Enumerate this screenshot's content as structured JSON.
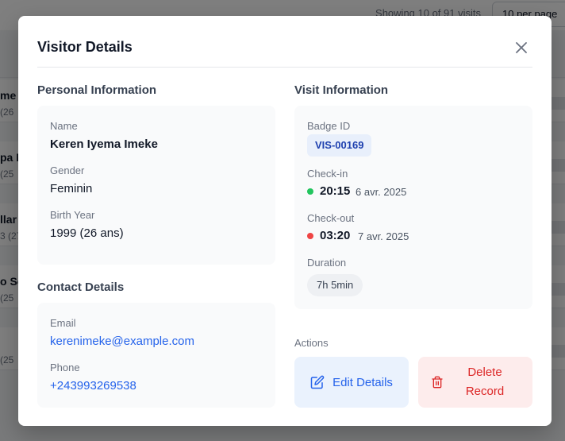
{
  "background": {
    "showing_text": "Showing 10 of 91 visits",
    "per_page": "10 per page",
    "rows": [
      {
        "name": "me",
        "sub": "(26"
      },
      {
        "name": "pa M",
        "sub": "(25"
      },
      {
        "name": "llar",
        "sub": "3 (27"
      },
      {
        "name": "o So",
        "sub": "(25"
      },
      {
        "name": "",
        "sub": "(25"
      }
    ]
  },
  "modal": {
    "title": "Visitor Details",
    "personal": {
      "title": "Personal Information",
      "name_label": "Name",
      "name_value": "Keren Iyema Imeke",
      "gender_label": "Gender",
      "gender_value": "Feminin",
      "birth_label": "Birth Year",
      "birth_value": "1999 (26 ans)"
    },
    "contact": {
      "title": "Contact Details",
      "email_label": "Email",
      "email_value": "kerenimeke@example.com",
      "phone_label": "Phone",
      "phone_value": "+243993269538"
    },
    "visit": {
      "title": "Visit Information",
      "badge_label": "Badge ID",
      "badge_value": "VIS-00169",
      "checkin_label": "Check-in",
      "checkin_time": "20:15",
      "checkin_date": "6 avr. 2025",
      "checkout_label": "Check-out",
      "checkout_time": "03:20",
      "checkout_date": "7 avr. 2025",
      "duration_label": "Duration",
      "duration_value": "7h 5min"
    },
    "actions": {
      "title": "Actions",
      "edit_label": "Edit Details",
      "delete_label": "Delete Record"
    }
  },
  "colors": {
    "accent_blue": "#2563eb",
    "danger_red": "#dc2626",
    "checkin_dot": "#22c55e",
    "checkout_dot": "#ef4444"
  },
  "icons": {
    "close": "close-icon",
    "edit": "edit-icon",
    "delete": "trash-icon"
  }
}
